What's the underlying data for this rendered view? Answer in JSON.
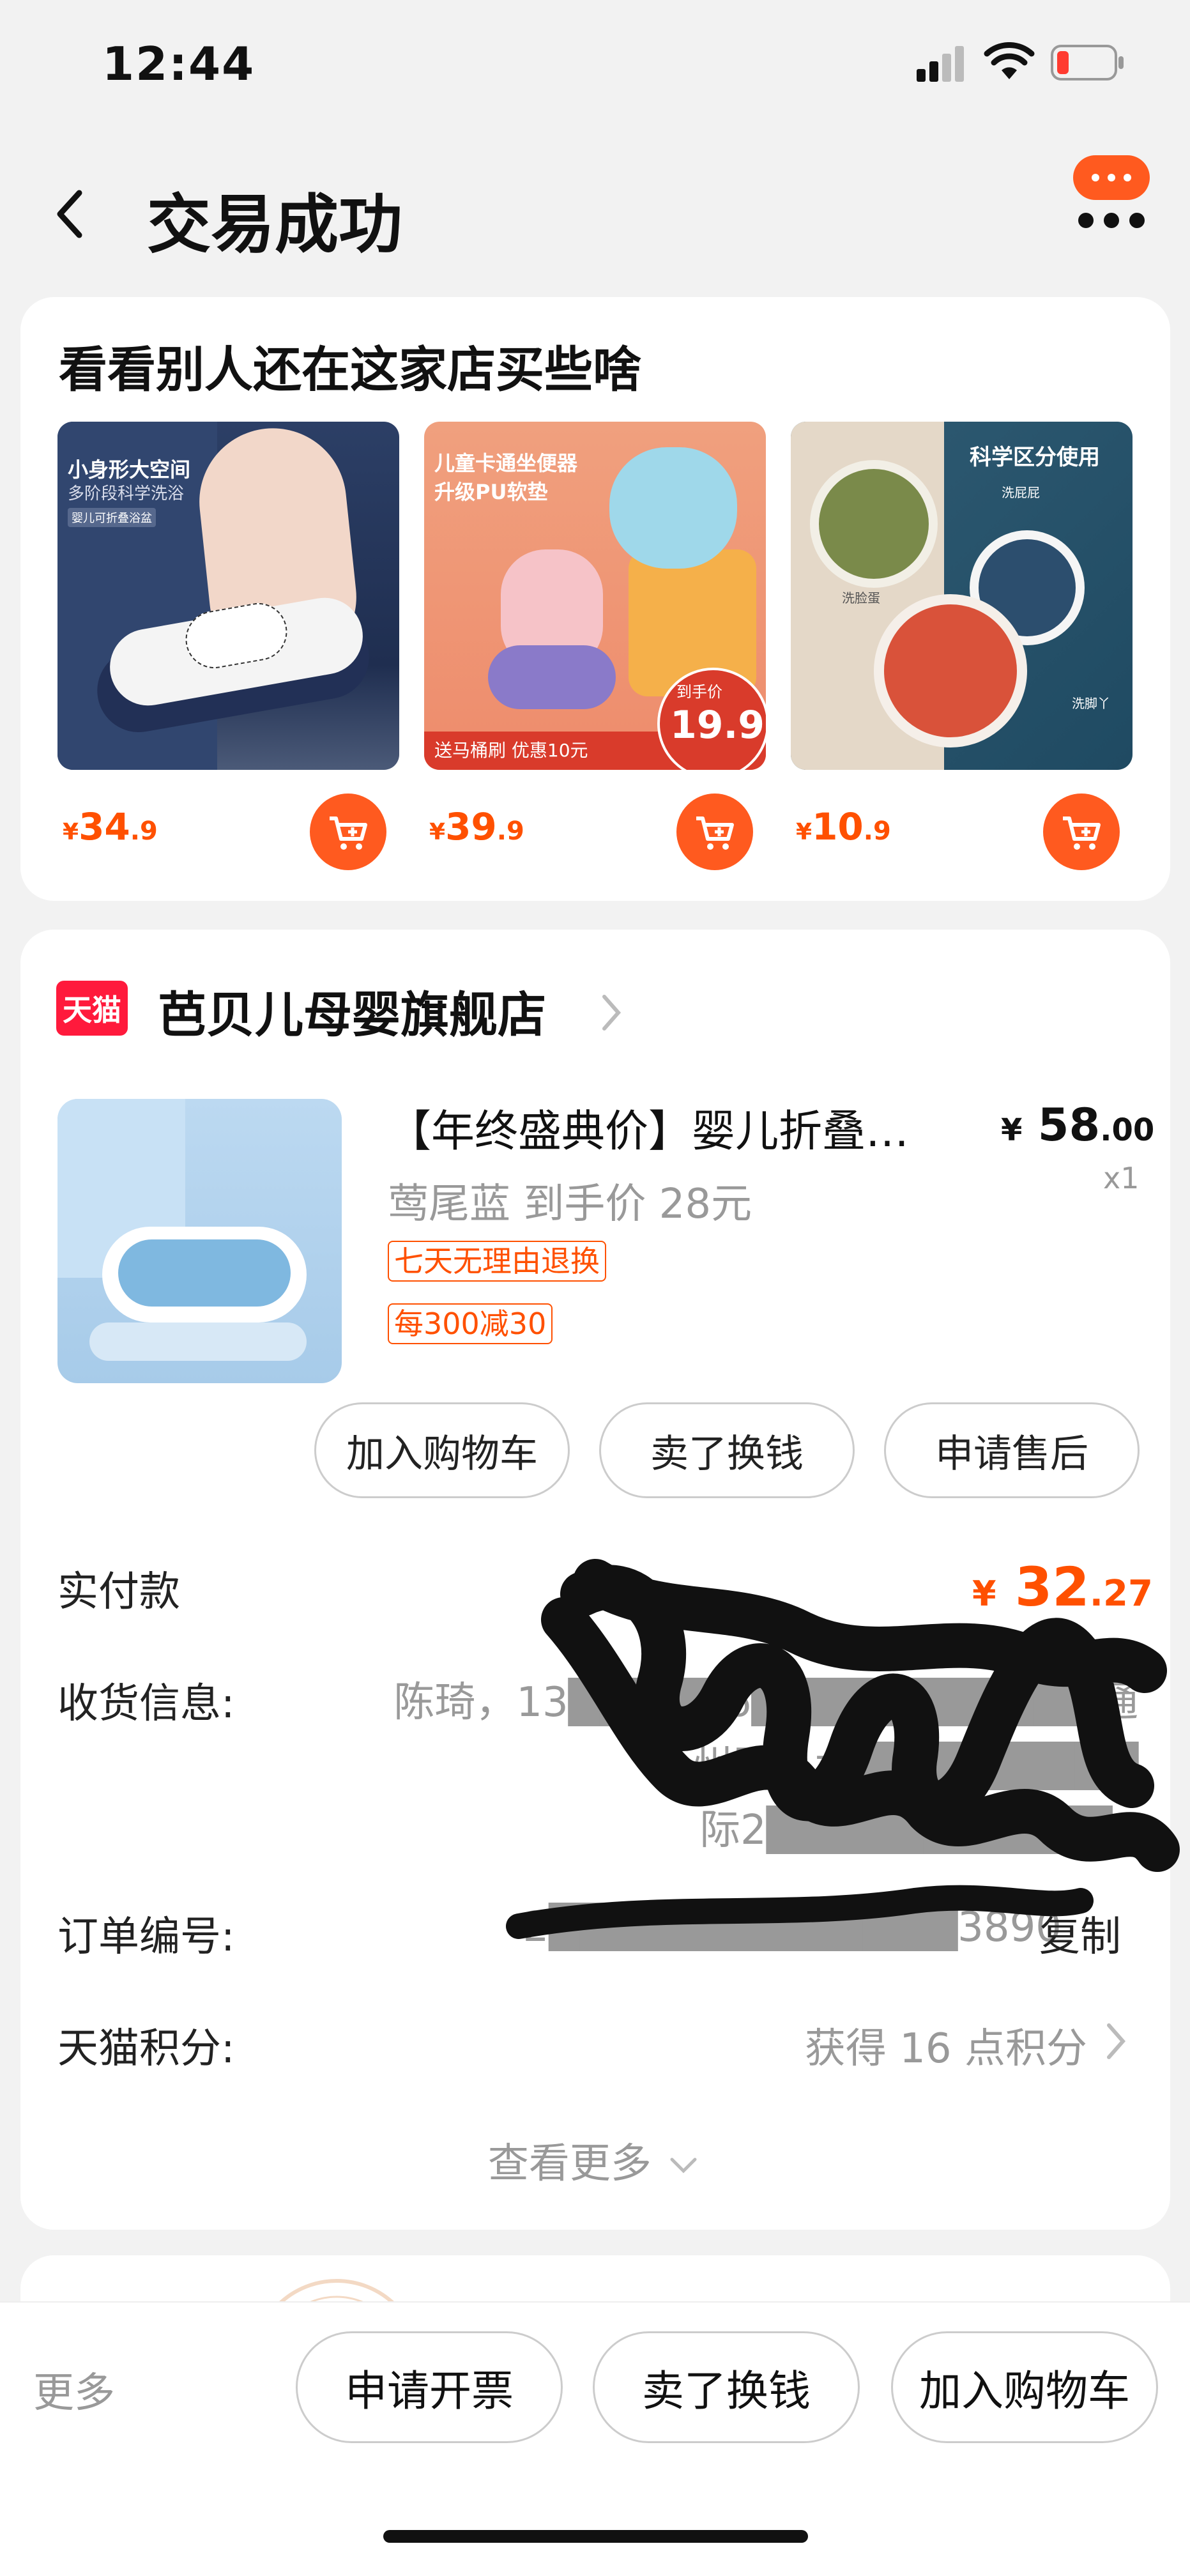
{
  "status": {
    "time": "12:44"
  },
  "nav": {
    "title": "交易成功"
  },
  "recommend": {
    "title": "看看别人还在这家店买些啥",
    "items": [
      {
        "headline": "小身形大空间",
        "sub": "多阶段科学洗浴",
        "tag": "婴儿可折叠浴盆",
        "price_int": "34",
        "price_dec": ".9"
      },
      {
        "headline": "儿童卡通坐便器",
        "sub": "升级PU软垫",
        "banner": "送马桶刷 优惠10元",
        "promo_label": "到手价",
        "promo_price": "19.9",
        "price_int": "39",
        "price_dec": ".9"
      },
      {
        "headline": "科学区分使用",
        "bowl_labels": [
          "洗屁屁",
          "洗脸蛋",
          "洗脚丫"
        ],
        "price_int": "10",
        "price_dec": ".9"
      }
    ],
    "currency": "¥"
  },
  "order": {
    "shop_badge": "天猫",
    "shop_name": "芭贝儿母婴旗舰店",
    "product_title": "【年终盛典价】婴儿折叠…",
    "price_int": "58",
    "price_dec": ".00",
    "currency": "¥",
    "qty": "x1",
    "spec": "莺尾蓝 到手价 28元",
    "tags": [
      "七天无理由退换",
      "每300减30"
    ],
    "actions": [
      "加入购物车",
      "卖了换钱",
      "申请售后"
    ],
    "paid_label": "实付款",
    "paid_int": "32",
    "paid_dec": ".27",
    "address_label": "收货信息:",
    "address_lines": [
      "陈琦，13█████6███████████通",
      "州区　北█████████",
      "际2███████████9"
    ],
    "order_no_label": "订单编号:",
    "order_no_value": "2█████████████3890",
    "copy_label": "复制",
    "points_label": "天猫积分:",
    "points_value": "获得 16 点积分",
    "see_more": "查看更多"
  },
  "bottom_bar": {
    "more": "更多",
    "buttons": [
      "申请开票",
      "卖了换钱",
      "加入购物车"
    ]
  },
  "colors": {
    "accent": "#ff5000",
    "tmall_red": "#ff1a3c",
    "background": "#f2f2f2"
  }
}
